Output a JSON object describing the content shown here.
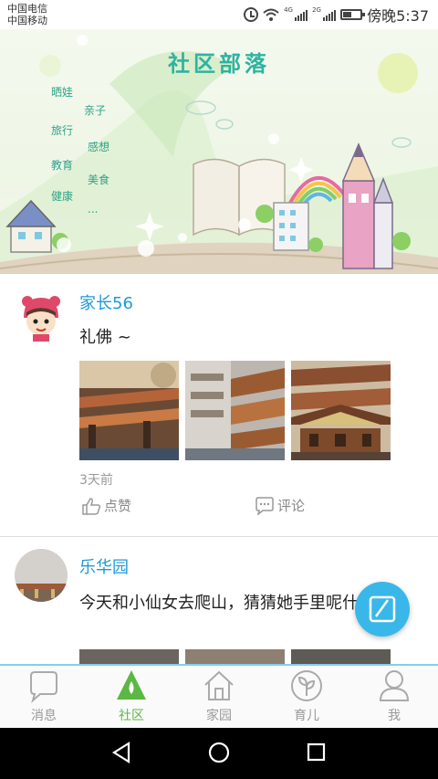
{
  "status_bar": {
    "carrier_1": "中国电信",
    "carrier_2": "中国移动",
    "signal_1_label": "4G",
    "signal_2_label": "2G",
    "time": "傍晚5:37"
  },
  "banner": {
    "title": "社区部落",
    "tags": [
      "晒娃",
      "亲子",
      "旅行",
      "感想",
      "教育",
      "美食",
      "健康",
      "..."
    ]
  },
  "posts": [
    {
      "username": "家长56",
      "text": "礼佛 ~",
      "time": "3天前",
      "like_label": "点赞",
      "comment_label": "评论"
    },
    {
      "username": "乐华园",
      "text": "今天和小仙女去爬山，猜猜她手里呢什么 ~"
    }
  ],
  "tabs": [
    {
      "label": "消息",
      "icon": "chat-bubble-icon"
    },
    {
      "label": "社区",
      "icon": "community-tent-icon",
      "active": true
    },
    {
      "label": "家园",
      "icon": "home-icon"
    },
    {
      "label": "育儿",
      "icon": "sprout-icon"
    },
    {
      "label": "我",
      "icon": "person-icon"
    }
  ],
  "colors": {
    "accent_blue": "#1f9ad6",
    "tab_active": "#5bb844",
    "fab": "#39b7e9"
  }
}
